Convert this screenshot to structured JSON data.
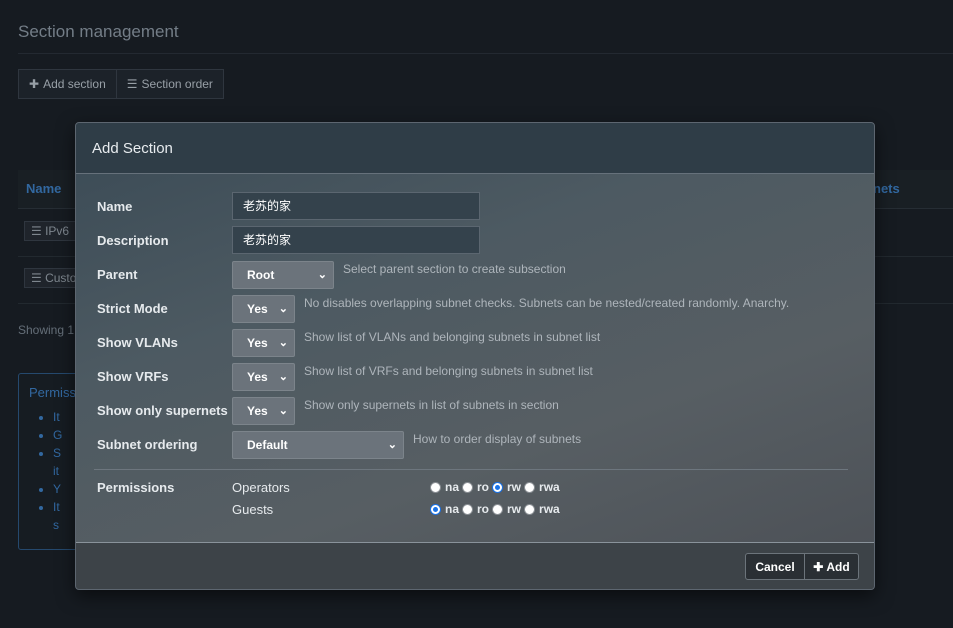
{
  "page": {
    "title": "Section management",
    "toolbar": {
      "add_section": "Add section",
      "section_order": "Section order",
      "add_icon": "plus-icon",
      "order_icon": "list-icon"
    }
  },
  "table": {
    "headers": {
      "name": "Name",
      "subnets": "nets"
    },
    "rows": [
      {
        "label": "IPv6"
      },
      {
        "label": "Custo"
      }
    ],
    "showing": "Showing 1"
  },
  "permissions_panel": {
    "heading": "Permiss",
    "items": [
      "It",
      "G",
      "S",
      "it",
      "Y",
      "It",
      "s"
    ]
  },
  "modal": {
    "title": "Add Section",
    "fields": {
      "name": {
        "label": "Name",
        "value": "老苏的家"
      },
      "description": {
        "label": "Description",
        "value": "老苏的家"
      },
      "parent": {
        "label": "Parent",
        "value": "Root",
        "help": "Select parent section to create subsection"
      },
      "strict_mode": {
        "label": "Strict Mode",
        "value": "Yes",
        "help": "No disables overlapping subnet checks. Subnets can be nested/created randomly. Anarchy."
      },
      "show_vlans": {
        "label": "Show VLANs",
        "value": "Yes",
        "help": "Show list of VLANs and belonging subnets in subnet list"
      },
      "show_vrfs": {
        "label": "Show VRFs",
        "value": "Yes",
        "help": "Show list of VRFs and belonging subnets in subnet list"
      },
      "show_supernets": {
        "label": "Show only supernets",
        "value": "Yes",
        "help": "Show only supernets in list of subnets in section"
      },
      "subnet_ordering": {
        "label": "Subnet ordering",
        "value": "Default",
        "help": "How to order display of subnets"
      }
    },
    "permissions": {
      "label": "Permissions",
      "options": [
        "na",
        "ro",
        "rw",
        "rwa"
      ],
      "groups": [
        {
          "name": "Operators",
          "selected": "rw"
        },
        {
          "name": "Guests",
          "selected": "na"
        }
      ]
    },
    "buttons": {
      "cancel": "Cancel",
      "add": "Add"
    }
  },
  "colors": {
    "accent": "#3d7fc4",
    "radio_checked": "#1a73e8"
  }
}
